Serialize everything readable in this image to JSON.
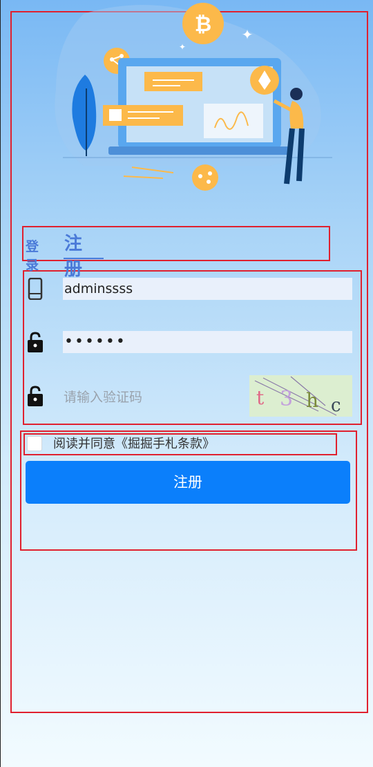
{
  "tabs": {
    "login": "登录",
    "register": "注册"
  },
  "form": {
    "phone_value": "adminssss",
    "password_value": "••••••",
    "captcha_placeholder": "请输入验证码",
    "captcha_text": "t3hc"
  },
  "agreement": {
    "text": "阅读并同意《掘掘手札条款》",
    "checked": false
  },
  "submit": {
    "label": "注册"
  },
  "icons": {
    "phone": "phone-icon",
    "lock": "lock-icon",
    "bitcoin": "bitcoin-icon",
    "ethereum": "ethereum-icon"
  },
  "colors": {
    "accent": "#0b7ffb",
    "tab": "#4a7ad8",
    "highlight": "#e0202e"
  }
}
